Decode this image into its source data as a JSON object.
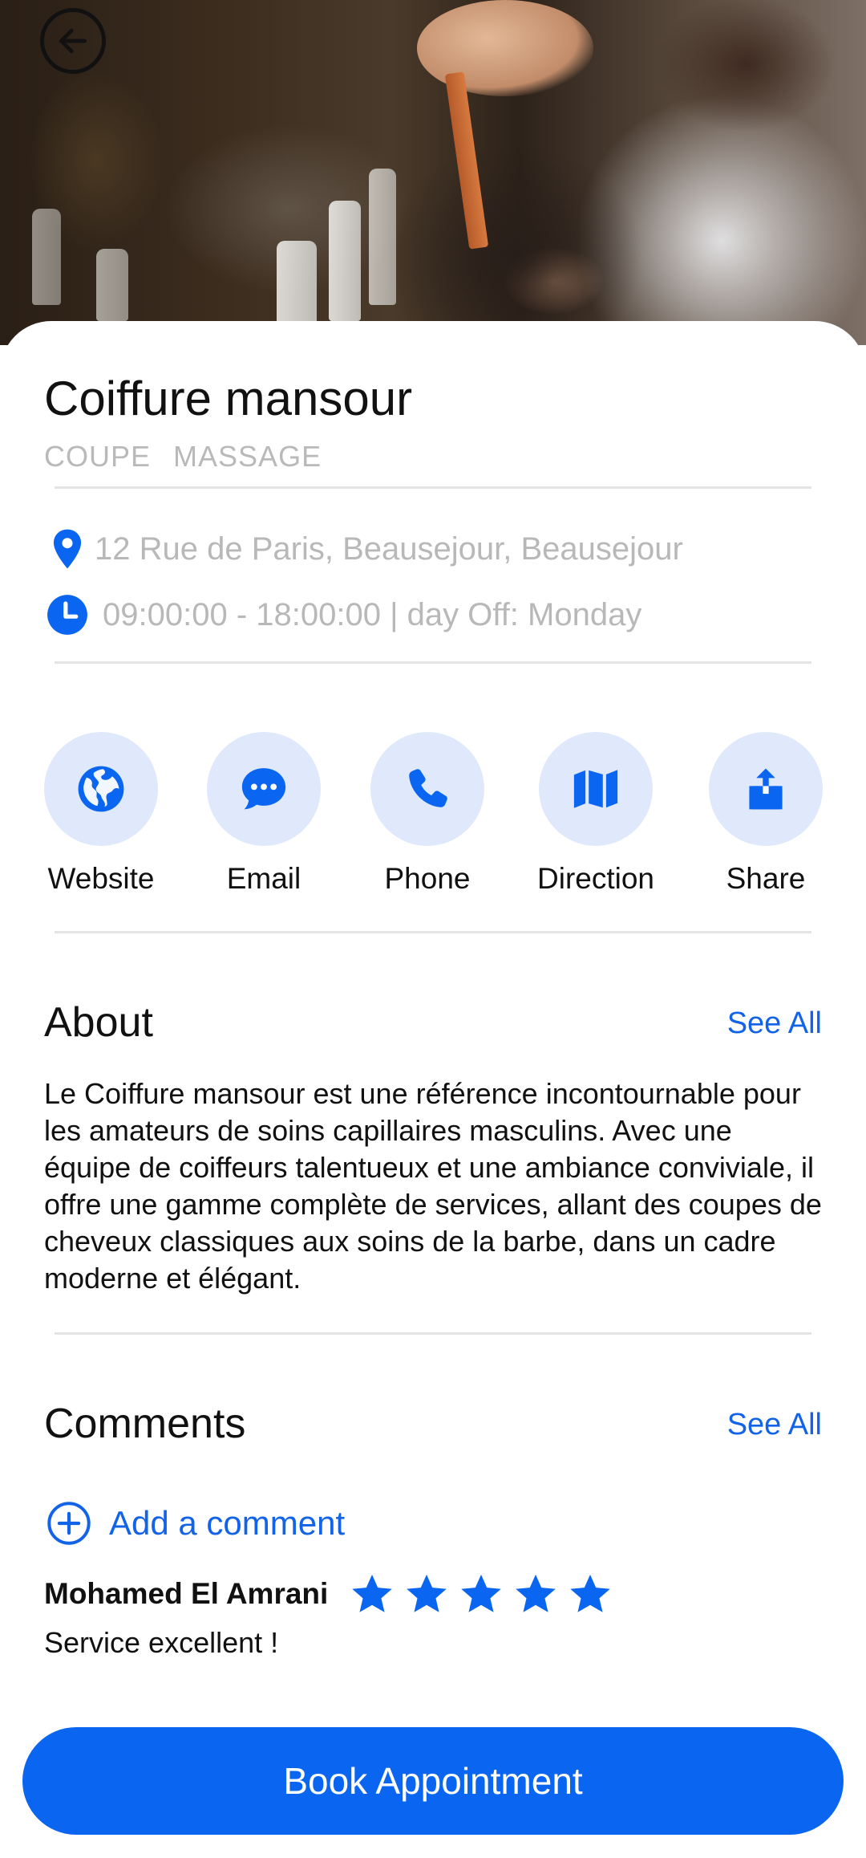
{
  "header": {
    "back_icon": "arrow-left-icon"
  },
  "place": {
    "name": "Coiffure mansour",
    "tags": [
      "COUPE",
      "MASSAGE"
    ],
    "address": "12 Rue de Paris, Beausejour, Beausejour",
    "hours": "09:00:00 - 18:00:00 | day Off: Monday"
  },
  "actions": [
    {
      "label": "Website",
      "icon": "globe-icon"
    },
    {
      "label": "Email",
      "icon": "chat-bubble-icon"
    },
    {
      "label": "Phone",
      "icon": "phone-icon"
    },
    {
      "label": "Direction",
      "icon": "map-icon"
    },
    {
      "label": "Share",
      "icon": "share-icon"
    }
  ],
  "about": {
    "title": "About",
    "see_all": "See All",
    "text": "Le Coiffure mansour est une référence incontournable pour les amateurs de soins capillaires masculins. Avec une équipe de coiffeurs talentueux et une ambiance conviviale, il offre une gamme complète de services, allant des coupes de cheveux classiques aux soins de la barbe, dans un cadre moderne et élégant."
  },
  "comments": {
    "title": "Comments",
    "see_all": "See All",
    "add_label": "Add a comment",
    "items": [
      {
        "author": "Mohamed El Amrani",
        "rating": 5,
        "max_rating": 5,
        "text": "Service excellent !"
      }
    ]
  },
  "cta": {
    "label": "Book Appointment"
  },
  "colors": {
    "accent": "#0A66F0",
    "icon_bg": "#DFE9FB",
    "muted_text": "#B8B8B8"
  }
}
